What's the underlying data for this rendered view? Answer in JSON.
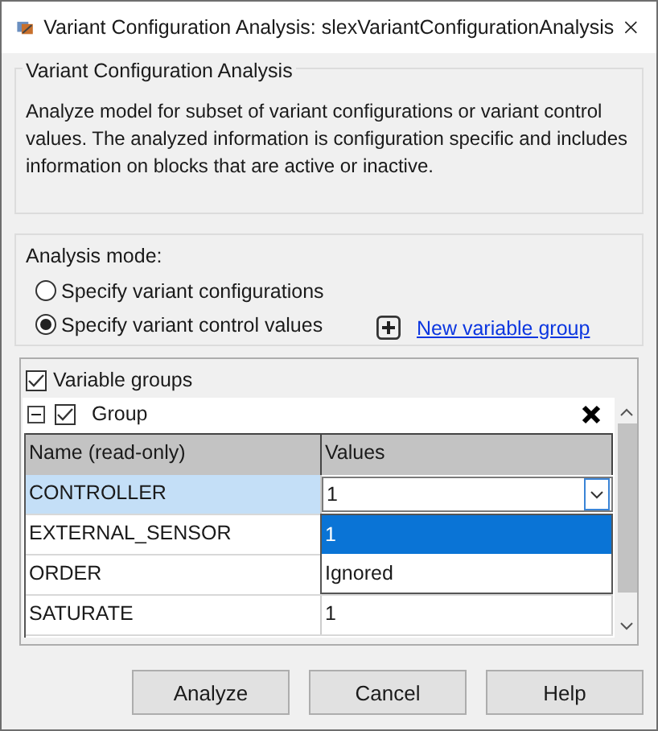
{
  "window": {
    "title": "Variant Configuration Analysis: slexVariantConfigurationAnalysis"
  },
  "description": {
    "heading": "Variant Configuration Analysis",
    "text": "Analyze model for subset of variant configurations or variant control values. The analyzed information is configuration specific and includes information on blocks that are active or inactive."
  },
  "analysis_mode": {
    "label": "Analysis mode:",
    "options": [
      {
        "label": "Specify variant configurations",
        "selected": false
      },
      {
        "label": "Specify variant control values",
        "selected": true
      }
    ],
    "new_group_link": "New variable group"
  },
  "variable_groups": {
    "label": "Variable groups",
    "checked": true,
    "group": {
      "name": "Group",
      "checked": true,
      "expanded": true
    },
    "columns": [
      "Name (read-only)",
      "Values"
    ],
    "rows": [
      {
        "name": "CONTROLLER",
        "value": "1",
        "selected": true,
        "editing": true
      },
      {
        "name": "EXTERNAL_SENSOR",
        "selected": false,
        "editing": false
      },
      {
        "name": "ORDER",
        "selected": false,
        "editing": false
      },
      {
        "name": "SATURATE",
        "value": "1",
        "selected": false,
        "editing": false
      }
    ],
    "dropdown": {
      "options": [
        {
          "label": "1",
          "selected": true
        },
        {
          "label": "Ignored",
          "selected": false
        }
      ]
    }
  },
  "buttons": [
    "Analyze",
    "Cancel",
    "Help"
  ]
}
